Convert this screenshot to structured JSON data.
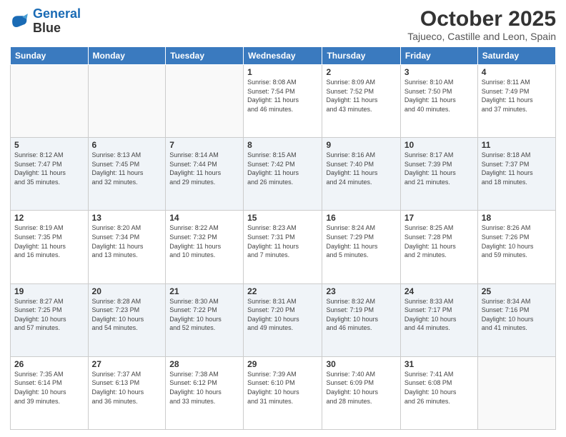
{
  "header": {
    "logo_line1": "General",
    "logo_line2": "Blue",
    "title": "October 2025",
    "subtitle": "Tajueco, Castille and Leon, Spain"
  },
  "weekdays": [
    "Sunday",
    "Monday",
    "Tuesday",
    "Wednesday",
    "Thursday",
    "Friday",
    "Saturday"
  ],
  "weeks": [
    [
      {
        "day": "",
        "info": ""
      },
      {
        "day": "",
        "info": ""
      },
      {
        "day": "",
        "info": ""
      },
      {
        "day": "1",
        "info": "Sunrise: 8:08 AM\nSunset: 7:54 PM\nDaylight: 11 hours\nand 46 minutes."
      },
      {
        "day": "2",
        "info": "Sunrise: 8:09 AM\nSunset: 7:52 PM\nDaylight: 11 hours\nand 43 minutes."
      },
      {
        "day": "3",
        "info": "Sunrise: 8:10 AM\nSunset: 7:50 PM\nDaylight: 11 hours\nand 40 minutes."
      },
      {
        "day": "4",
        "info": "Sunrise: 8:11 AM\nSunset: 7:49 PM\nDaylight: 11 hours\nand 37 minutes."
      }
    ],
    [
      {
        "day": "5",
        "info": "Sunrise: 8:12 AM\nSunset: 7:47 PM\nDaylight: 11 hours\nand 35 minutes."
      },
      {
        "day": "6",
        "info": "Sunrise: 8:13 AM\nSunset: 7:45 PM\nDaylight: 11 hours\nand 32 minutes."
      },
      {
        "day": "7",
        "info": "Sunrise: 8:14 AM\nSunset: 7:44 PM\nDaylight: 11 hours\nand 29 minutes."
      },
      {
        "day": "8",
        "info": "Sunrise: 8:15 AM\nSunset: 7:42 PM\nDaylight: 11 hours\nand 26 minutes."
      },
      {
        "day": "9",
        "info": "Sunrise: 8:16 AM\nSunset: 7:40 PM\nDaylight: 11 hours\nand 24 minutes."
      },
      {
        "day": "10",
        "info": "Sunrise: 8:17 AM\nSunset: 7:39 PM\nDaylight: 11 hours\nand 21 minutes."
      },
      {
        "day": "11",
        "info": "Sunrise: 8:18 AM\nSunset: 7:37 PM\nDaylight: 11 hours\nand 18 minutes."
      }
    ],
    [
      {
        "day": "12",
        "info": "Sunrise: 8:19 AM\nSunset: 7:35 PM\nDaylight: 11 hours\nand 16 minutes."
      },
      {
        "day": "13",
        "info": "Sunrise: 8:20 AM\nSunset: 7:34 PM\nDaylight: 11 hours\nand 13 minutes."
      },
      {
        "day": "14",
        "info": "Sunrise: 8:22 AM\nSunset: 7:32 PM\nDaylight: 11 hours\nand 10 minutes."
      },
      {
        "day": "15",
        "info": "Sunrise: 8:23 AM\nSunset: 7:31 PM\nDaylight: 11 hours\nand 7 minutes."
      },
      {
        "day": "16",
        "info": "Sunrise: 8:24 AM\nSunset: 7:29 PM\nDaylight: 11 hours\nand 5 minutes."
      },
      {
        "day": "17",
        "info": "Sunrise: 8:25 AM\nSunset: 7:28 PM\nDaylight: 11 hours\nand 2 minutes."
      },
      {
        "day": "18",
        "info": "Sunrise: 8:26 AM\nSunset: 7:26 PM\nDaylight: 10 hours\nand 59 minutes."
      }
    ],
    [
      {
        "day": "19",
        "info": "Sunrise: 8:27 AM\nSunset: 7:25 PM\nDaylight: 10 hours\nand 57 minutes."
      },
      {
        "day": "20",
        "info": "Sunrise: 8:28 AM\nSunset: 7:23 PM\nDaylight: 10 hours\nand 54 minutes."
      },
      {
        "day": "21",
        "info": "Sunrise: 8:30 AM\nSunset: 7:22 PM\nDaylight: 10 hours\nand 52 minutes."
      },
      {
        "day": "22",
        "info": "Sunrise: 8:31 AM\nSunset: 7:20 PM\nDaylight: 10 hours\nand 49 minutes."
      },
      {
        "day": "23",
        "info": "Sunrise: 8:32 AM\nSunset: 7:19 PM\nDaylight: 10 hours\nand 46 minutes."
      },
      {
        "day": "24",
        "info": "Sunrise: 8:33 AM\nSunset: 7:17 PM\nDaylight: 10 hours\nand 44 minutes."
      },
      {
        "day": "25",
        "info": "Sunrise: 8:34 AM\nSunset: 7:16 PM\nDaylight: 10 hours\nand 41 minutes."
      }
    ],
    [
      {
        "day": "26",
        "info": "Sunrise: 7:35 AM\nSunset: 6:14 PM\nDaylight: 10 hours\nand 39 minutes."
      },
      {
        "day": "27",
        "info": "Sunrise: 7:37 AM\nSunset: 6:13 PM\nDaylight: 10 hours\nand 36 minutes."
      },
      {
        "day": "28",
        "info": "Sunrise: 7:38 AM\nSunset: 6:12 PM\nDaylight: 10 hours\nand 33 minutes."
      },
      {
        "day": "29",
        "info": "Sunrise: 7:39 AM\nSunset: 6:10 PM\nDaylight: 10 hours\nand 31 minutes."
      },
      {
        "day": "30",
        "info": "Sunrise: 7:40 AM\nSunset: 6:09 PM\nDaylight: 10 hours\nand 28 minutes."
      },
      {
        "day": "31",
        "info": "Sunrise: 7:41 AM\nSunset: 6:08 PM\nDaylight: 10 hours\nand 26 minutes."
      },
      {
        "day": "",
        "info": ""
      }
    ]
  ]
}
